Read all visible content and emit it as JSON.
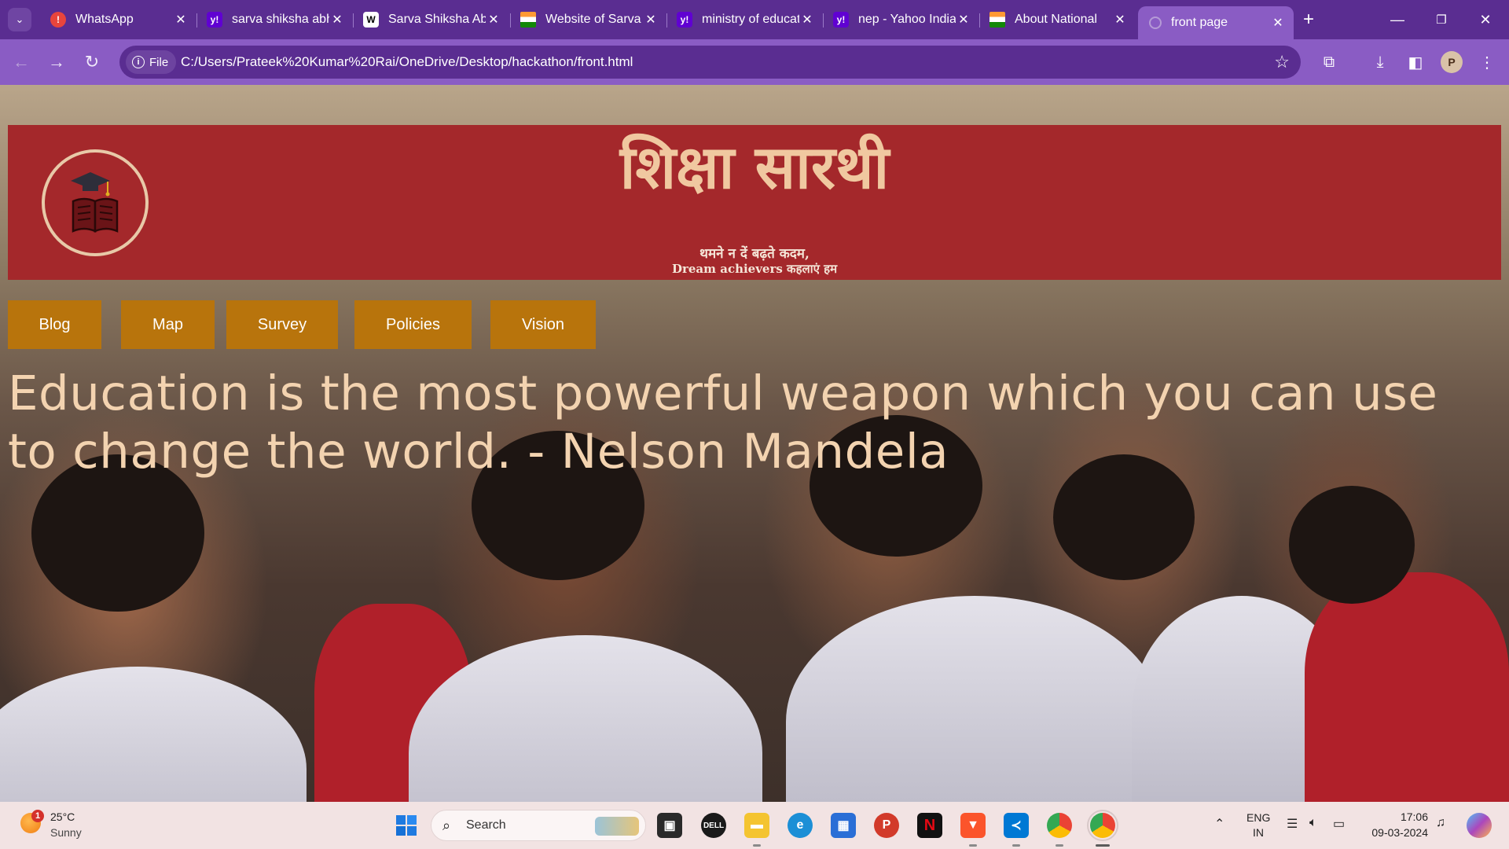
{
  "browser": {
    "tabs": [
      {
        "title": "WhatsApp",
        "icon": "whatsapp-icon"
      },
      {
        "title": "sarva shiksha abhiyan",
        "icon": "yahoo-icon"
      },
      {
        "title": "Sarva Shiksha Abhiyan",
        "icon": "wikipedia-icon"
      },
      {
        "title": "Website of Sarva",
        "icon": "india-flag-icon"
      },
      {
        "title": "ministry of education",
        "icon": "yahoo-icon"
      },
      {
        "title": "nep - Yahoo India",
        "icon": "yahoo-icon"
      },
      {
        "title": "About National",
        "icon": "india-flag-icon"
      },
      {
        "title": "front page",
        "icon": "globe-icon",
        "active": true
      }
    ],
    "chip_label": "File",
    "url": "C:/Users/Prateek%20Kumar%20Rai/OneDrive/Desktop/hackathon/front.html"
  },
  "page": {
    "title": "शिक्षा सारथी",
    "tagline_1": "थमने न दें बढ़ते कदम,",
    "tagline_2": "Dream achievers कहलाएं हम",
    "nav": [
      "Blog",
      "Map",
      "Survey",
      "Policies",
      "Vision"
    ],
    "quote": "Education is the most powerful weapon which you can use to change the world. - Nelson Mandela"
  },
  "taskbar": {
    "weather_temp": "25°C",
    "weather_desc": "Sunny",
    "weather_badge": "1",
    "search_placeholder": "Search",
    "lang_1": "ENG",
    "lang_2": "IN",
    "time": "17:06",
    "date": "09-03-2024"
  },
  "colors": {
    "browser_frame": "#5a2d91",
    "header_bg": "#a4282b",
    "title_text": "#f0c8a0",
    "nav_bg": "#b8740c",
    "quote_text": "#f3d3b0"
  }
}
